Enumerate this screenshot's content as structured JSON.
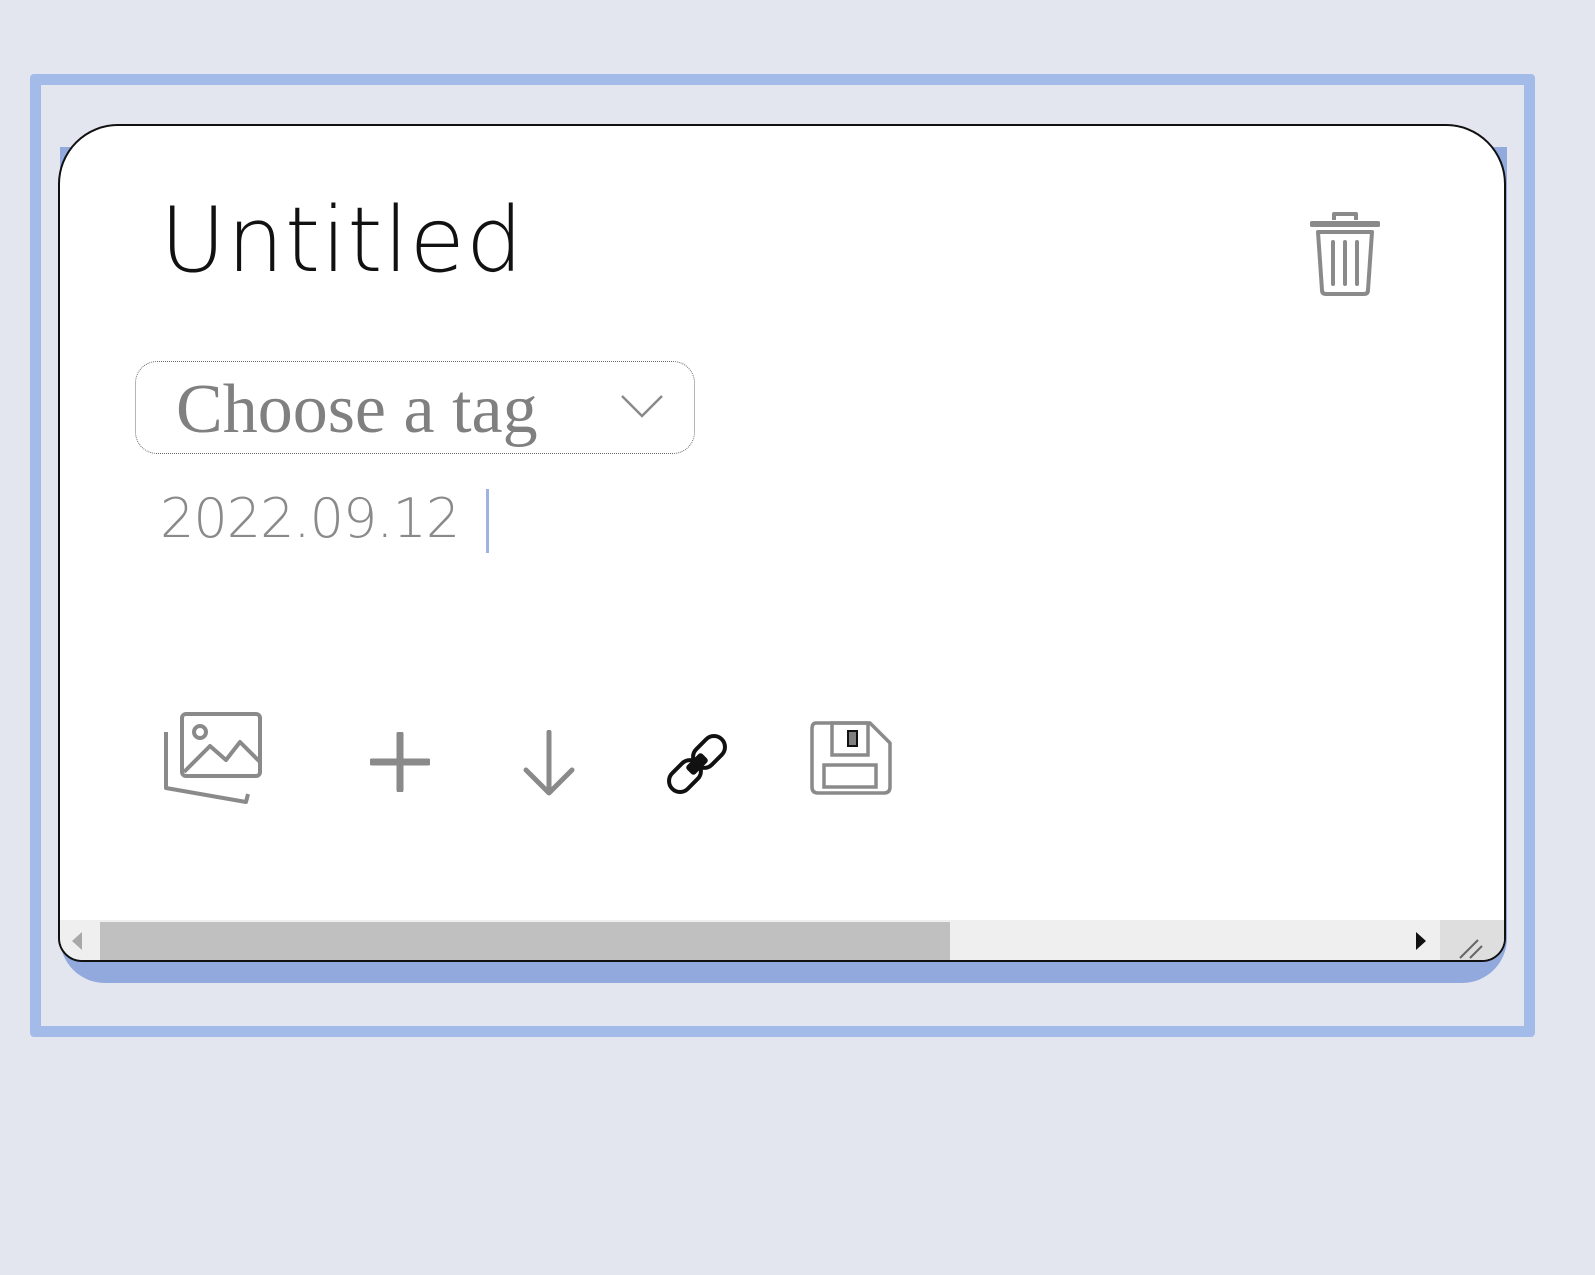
{
  "note": {
    "title": "Untitled",
    "date": "2022.09.12"
  },
  "tag_select": {
    "placeholder": "Choose a tag"
  },
  "icons": {
    "delete": "trash-icon",
    "insert_image": "image-gallery-icon",
    "add": "plus-icon",
    "download": "arrow-down-icon",
    "link": "link-chain-icon",
    "save": "floppy-disk-icon",
    "dropdown": "chevron-down-icon"
  },
  "colors": {
    "background": "#e3e6ef",
    "focus_frame": "#a3bbe8",
    "card_shadow": "#92a9dd",
    "card": "#ffffff",
    "icon_gray": "#8a8a8a",
    "text_dark": "#111111",
    "caret": "#9fb3e0"
  }
}
